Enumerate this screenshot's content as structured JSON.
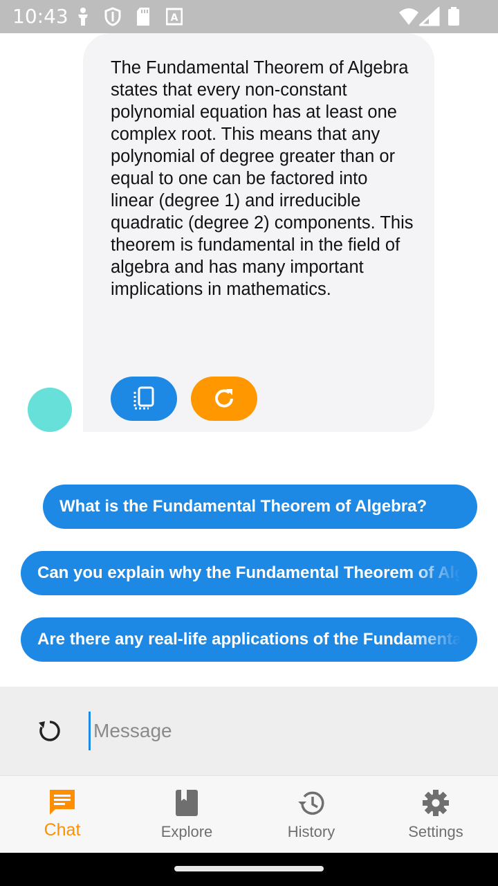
{
  "status_bar": {
    "time": "10:43"
  },
  "assistant": {
    "message": "The Fundamental Theorem of Algebra states that every non-constant polynomial equation has at least one complex root. This means that any polynomial of degree greater than or equal to one can be factored into linear (degree 1) and irreducible quadratic (degree 2) components. This theorem is fundamental in the field of algebra and has many important implications in mathematics.",
    "avatar_color": "#66e0d8"
  },
  "suggestions": [
    "What is the Fundamental Theorem of Algebra?",
    "Can you explain why the Fundamental Theorem of Algebra is important?",
    "Are there any real-life applications of the Fundamental Theorem of Algebra?"
  ],
  "input": {
    "placeholder": "Message"
  },
  "nav": {
    "items": [
      {
        "label": "Chat"
      },
      {
        "label": "Explore"
      },
      {
        "label": "History"
      },
      {
        "label": "Settings"
      }
    ]
  },
  "colors": {
    "primary": "#1e88e5",
    "accent": "#ff9800",
    "active_nav": "#ff8f00"
  }
}
